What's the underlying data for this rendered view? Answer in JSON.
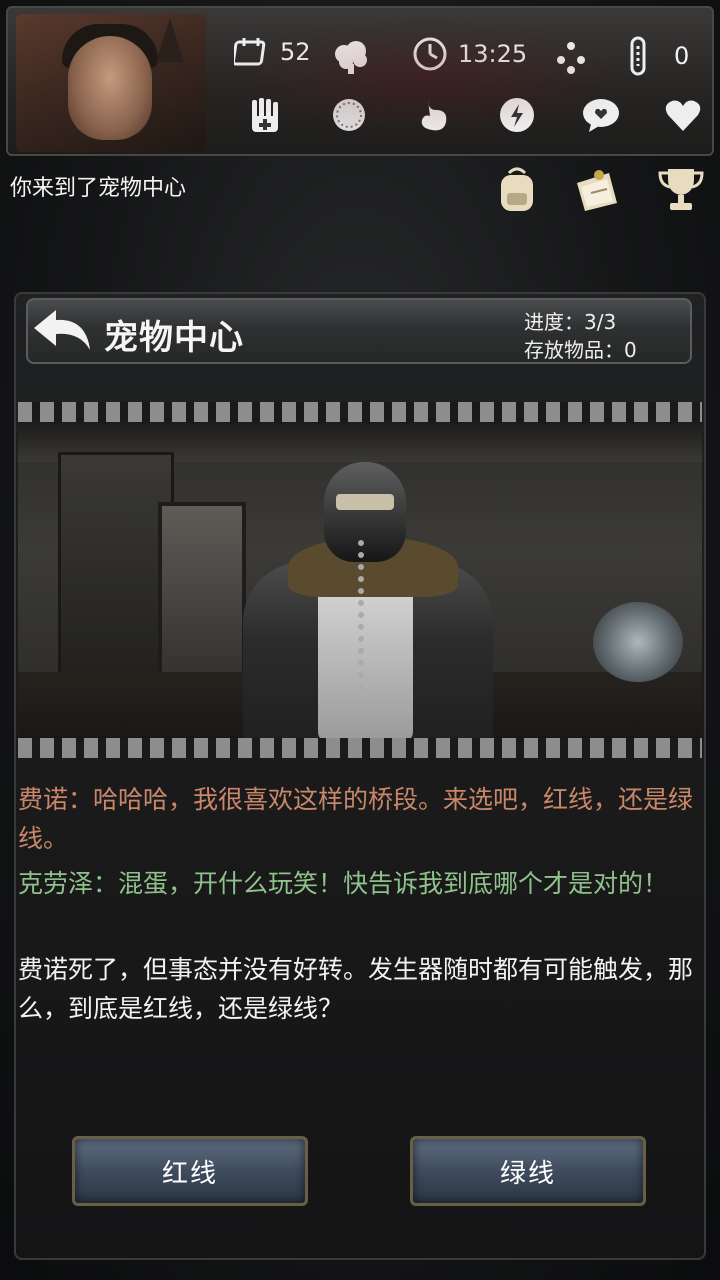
{
  "hud": {
    "days": "52",
    "time": "13:25",
    "temperature": "0",
    "icons": [
      "calendar-icon",
      "brain-cloud-icon",
      "clock-icon",
      "snowflake-icon",
      "thermometer-icon",
      "hand-medical-icon",
      "virus-icon",
      "stomach-icon",
      "energy-icon",
      "mood-icon",
      "heart-icon"
    ]
  },
  "location": {
    "text": "你来到了宠物中心",
    "icons": [
      "backpack-icon",
      "notes-icon",
      "trophy-icon"
    ]
  },
  "panel": {
    "title": "宠物中心",
    "progress": "进度：3/3",
    "stored_items": "存放物品：0"
  },
  "dialogue": {
    "line1": "费诺：哈哈哈，我很喜欢这样的桥段。来选吧，红线，还是绿线。",
    "line2": "克劳泽：混蛋，开什么玩笑！快告诉我到底哪个才是对的！",
    "line3": "费诺死了，但事态并没有好转。发生器随时都有可能触发，那么，到底是红线，还是绿线？"
  },
  "choices": {
    "red": "红线",
    "green": "绿线"
  },
  "colors": {
    "speaker1": "#c9876a",
    "speaker2": "#8fc28b",
    "narration": "#f2f2f2",
    "button": "#3f4c5e"
  }
}
